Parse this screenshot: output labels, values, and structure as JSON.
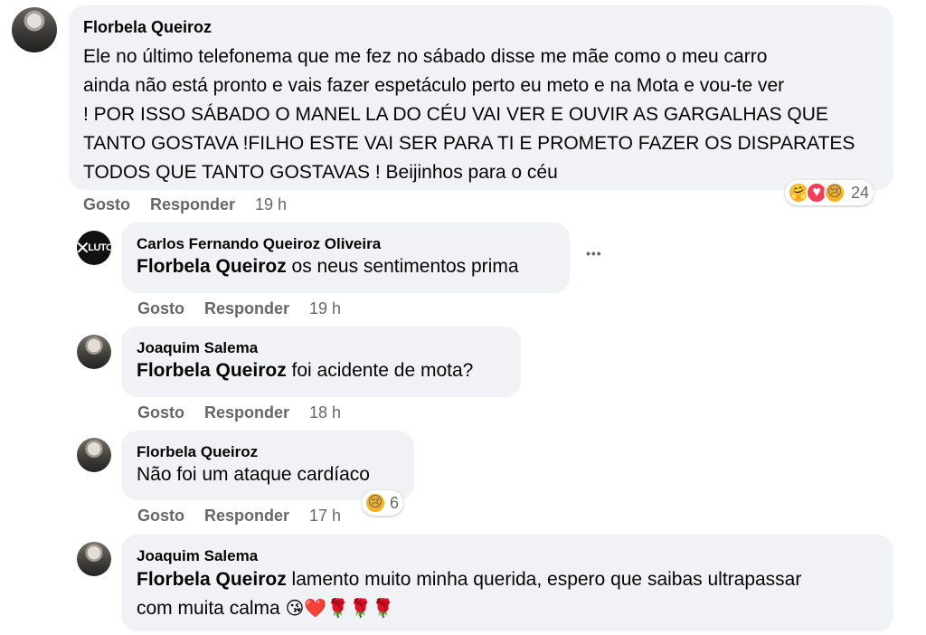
{
  "comments": [
    {
      "author": "Florbela Queiroz",
      "lines": [
        "Ele no último telefonema que me fez no sábado disse me mãe como o meu carro",
        "ainda não está pronto e vais fazer espetáculo perto eu meto e na Mota e vou-te ver",
        "! POR ISSO SÁBADO O MANEL LA DO CÉU VAI VER E OUVIR AS GARGALHAS QUE",
        "TANTO GOSTAVA !FILHO ESTE VAI SER PARA TI E PROMETO FAZER OS DISPARATES",
        "TODOS QUE TANTO GOSTAVAS ! Beijinhos para o céu"
      ],
      "like_label": "Gosto",
      "reply_label": "Responder",
      "time": "19 h",
      "reaction_count": "24",
      "reactions": [
        "care",
        "love",
        "sad"
      ]
    }
  ],
  "replies": [
    {
      "author": "Carlos Fernando Queiroz Oliveira",
      "mention": "Florbela Queiroz",
      "text": " os neus sentimentos prima",
      "like_label": "Gosto",
      "reply_label": "Responder",
      "time": "19 h",
      "avatar_text": "LUTO",
      "more_label": "•••"
    },
    {
      "author": "Joaquim Salema",
      "mention": "Florbela Queiroz",
      "text": " foi acidente de mota?",
      "like_label": "Gosto",
      "reply_label": "Responder",
      "time": "18 h"
    },
    {
      "author": "Florbela Queiroz",
      "text": "Não foi um ataque cardíaco",
      "like_label": "Gosto",
      "reply_label": "Responder",
      "time": "17 h",
      "reaction_count": "6",
      "reactions": [
        "sad"
      ]
    },
    {
      "author": "Joaquim Salema",
      "mention": "Florbela Queiroz",
      "line1": " lamento muito minha querida, espero que saibas ultrapassar",
      "line2": "com muita calma ",
      "emojis": "😘❤️🌹🌹🌹"
    }
  ]
}
